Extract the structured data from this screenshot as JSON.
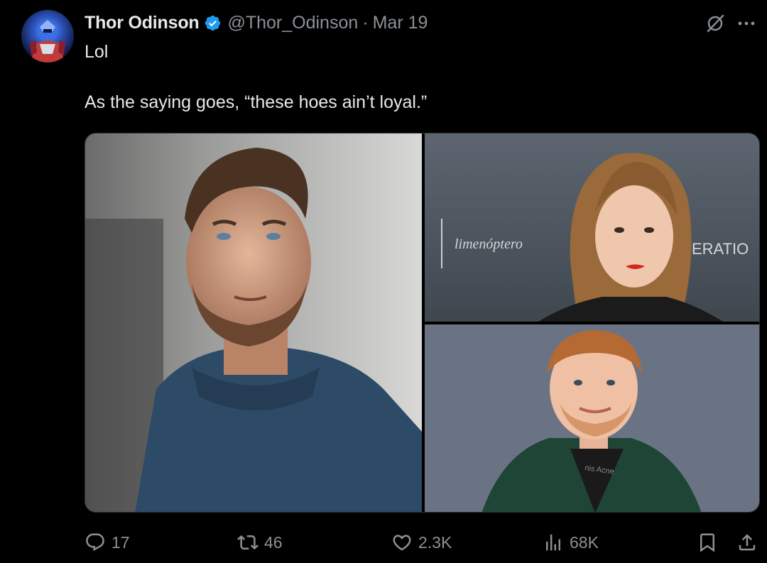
{
  "tweet": {
    "author": {
      "display_name": "Thor Odinson",
      "handle": "@Thor_Odinson",
      "verified": true,
      "avatar_icon": "avatar-image"
    },
    "separator": "·",
    "date": "Mar 19",
    "text_line1": "Lol",
    "text_line2": "As the saying goes, “these hoes ain’t loyal.”",
    "media": {
      "count": 3,
      "top_right_backdrop_text": "limenóptero",
      "top_right_backdrop_text_right": "ERATIO",
      "bottom_right_shirt_text": "nis Acne"
    },
    "actions": {
      "replies": "17",
      "reposts": "46",
      "likes": "2.3K",
      "views": "68K"
    }
  },
  "colors": {
    "background": "#000000",
    "text_primary": "#e7e9ea",
    "text_secondary": "#8b9096",
    "verified_blue": "#1d9bf0",
    "border": "#2f3336"
  }
}
